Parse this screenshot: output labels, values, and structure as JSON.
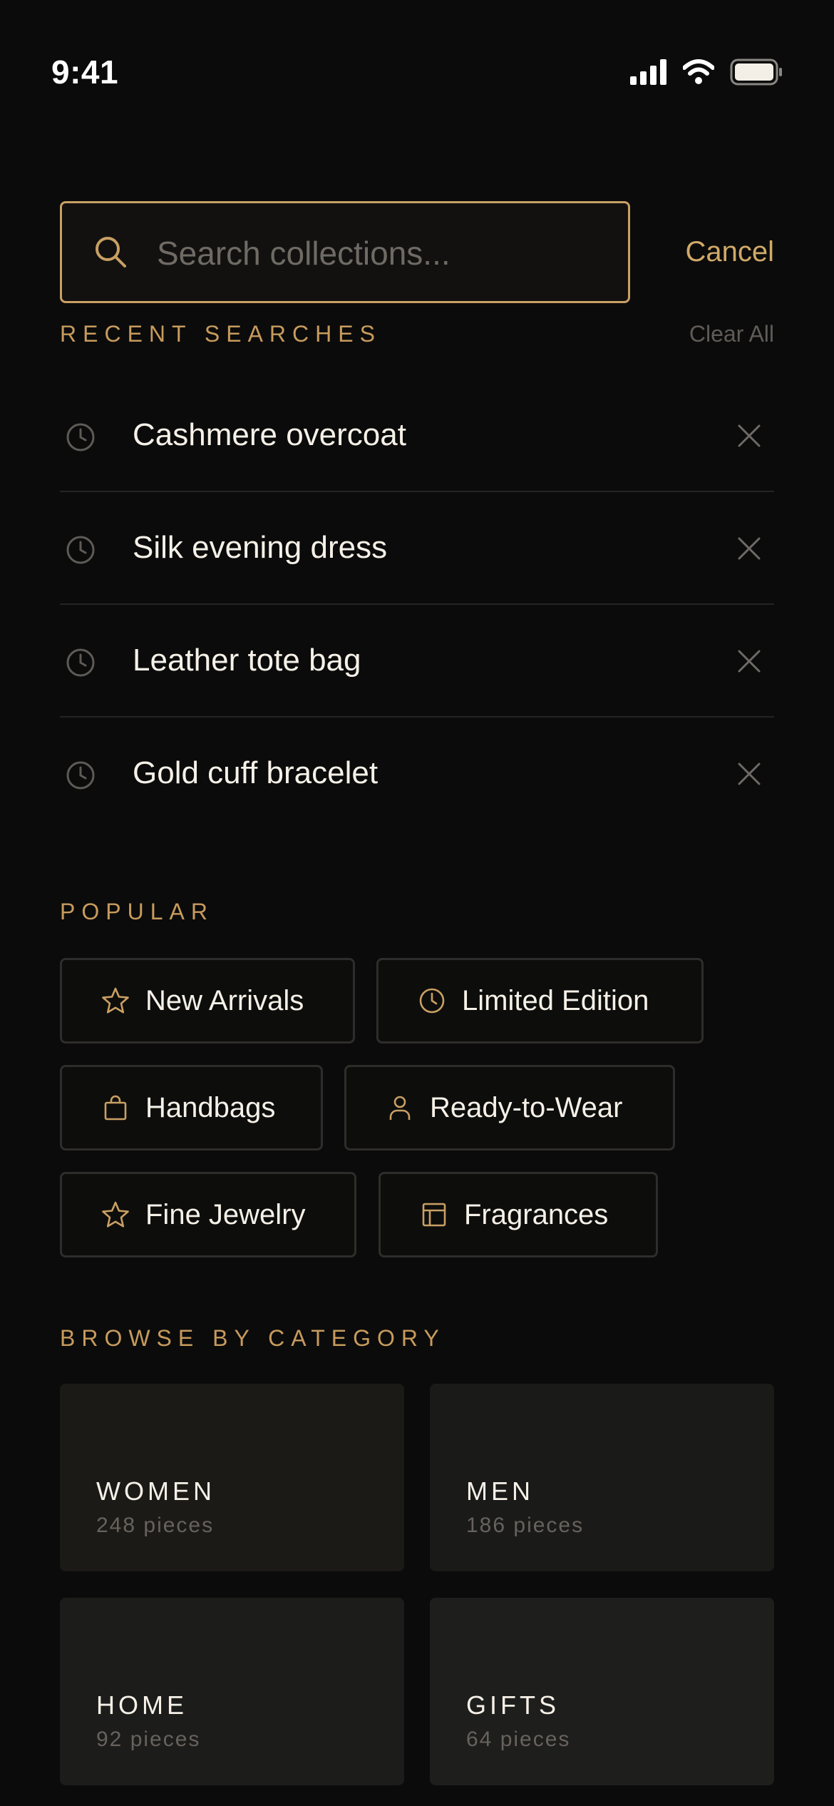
{
  "status_bar": {
    "time": "9:41"
  },
  "search": {
    "placeholder": "Search collections...",
    "value": "",
    "cancel_label": "Cancel"
  },
  "recent": {
    "heading": "RECENT SEARCHES",
    "clear_label": "Clear All",
    "items": [
      {
        "label": "Cashmere overcoat"
      },
      {
        "label": "Silk evening dress"
      },
      {
        "label": "Leather tote bag"
      },
      {
        "label": "Gold cuff bracelet"
      }
    ]
  },
  "popular": {
    "heading": "POPULAR",
    "chips": [
      {
        "label": "New Arrivals",
        "icon": "star-icon"
      },
      {
        "label": "Limited Edition",
        "icon": "clock-icon"
      },
      {
        "label": "Handbags",
        "icon": "bag-icon"
      },
      {
        "label": "Ready-to-Wear",
        "icon": "person-icon"
      },
      {
        "label": "Fine Jewelry",
        "icon": "star-icon"
      },
      {
        "label": "Fragrances",
        "icon": "panel-icon"
      }
    ]
  },
  "categories": {
    "heading": "BROWSE BY CATEGORY",
    "items": [
      {
        "name": "WOMEN",
        "count": "248 pieces"
      },
      {
        "name": "MEN",
        "count": "186 pieces"
      },
      {
        "name": "HOME",
        "count": "92 pieces"
      },
      {
        "name": "GIFTS",
        "count": "64 pieces"
      }
    ]
  },
  "colors": {
    "background": "#0b0b0b",
    "accent_gold": "#c9a063",
    "text_primary": "#f6f1e8",
    "text_muted": "#67625c",
    "divider": "#252423"
  }
}
